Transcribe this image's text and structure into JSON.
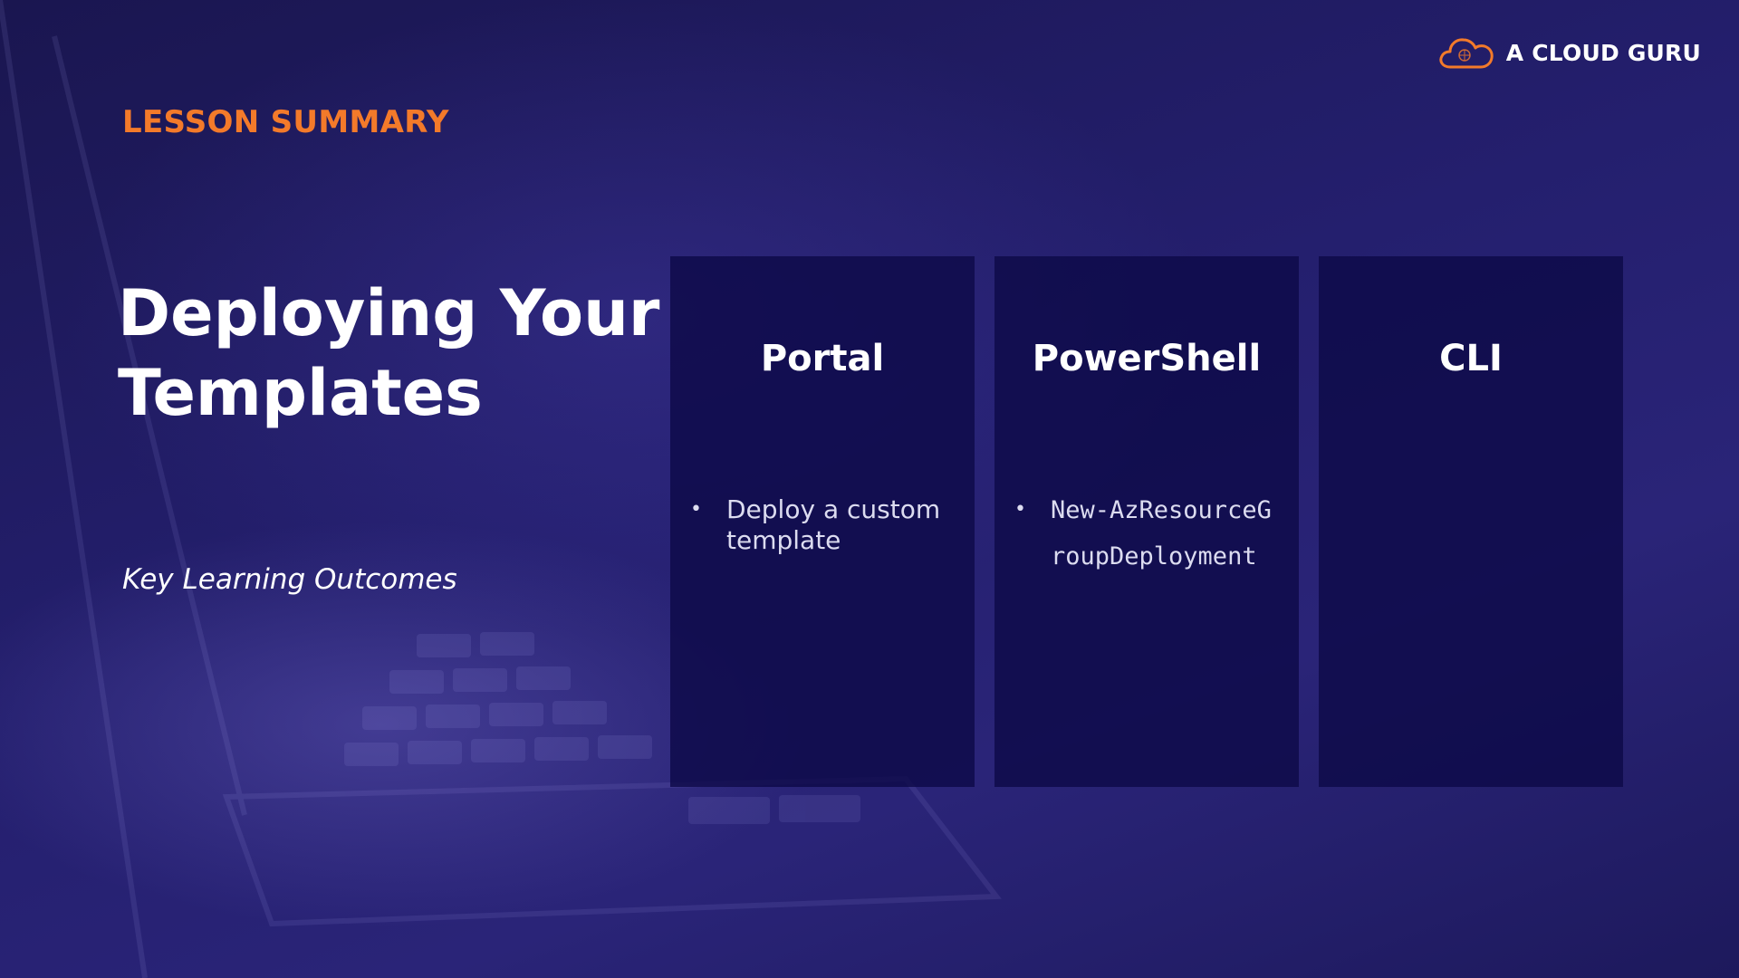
{
  "brand": {
    "name": "A CLOUD GURU",
    "logo_icon": "cloud-icon",
    "accent_color": "#f37a2a"
  },
  "eyebrow": "LESSON SUMMARY",
  "title": {
    "line1": "Deploying Your",
    "line2": "Templates"
  },
  "subtitle": "Key Learning Outcomes",
  "cards": [
    {
      "heading": "Portal",
      "bullets": [
        "Deploy a custom template"
      ]
    },
    {
      "heading": "PowerShell",
      "bullets": [
        "New-AzResourceGroupDeployment"
      ]
    },
    {
      "heading": "CLI",
      "bullets": []
    }
  ],
  "colors": {
    "background": "#1e1a5c",
    "card": "#0e0a48",
    "heading_text": "#ffffff"
  }
}
